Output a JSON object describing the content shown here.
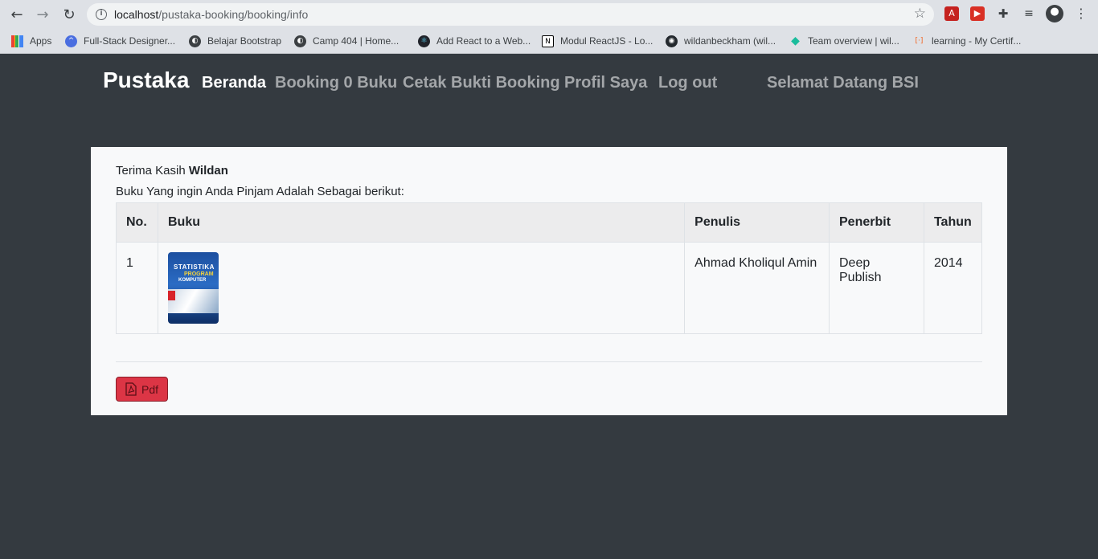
{
  "browser": {
    "url_host": "localhost",
    "url_path": "/pustaka-booking/booking/info",
    "bookmarks": [
      {
        "label": "Apps",
        "icon": "apps-grid-icon"
      },
      {
        "label": "Full-Stack Designer...",
        "icon": "site-icon"
      },
      {
        "label": "Belajar Bootstrap",
        "icon": "globe-icon"
      },
      {
        "label": "Camp 404 | Home...",
        "icon": "globe-icon"
      },
      {
        "label": "Add React to a Web...",
        "icon": "react-icon"
      },
      {
        "label": "Modul ReactJS - Lo...",
        "icon": "notion-icon"
      },
      {
        "label": "wildanbeckham (wil...",
        "icon": "github-icon"
      },
      {
        "label": "Team overview | wil...",
        "icon": "diamond-icon"
      },
      {
        "label": "learning - My Certif...",
        "icon": "code-icon"
      }
    ]
  },
  "navbar": {
    "brand": "Pustaka",
    "links": [
      "Beranda",
      "Booking 0 Buku",
      "Cetak Bukti Booking",
      "Profil Saya",
      "Log out"
    ],
    "welcome": "Selamat Datang BSI"
  },
  "info": {
    "thanks_prefix": "Terima Kasih",
    "name": "Wildan",
    "subtitle": "Buku Yang ingin Anda Pinjam Adalah Sebagai berikut:"
  },
  "table": {
    "headers": [
      "No.",
      "Buku",
      "Penulis",
      "Penerbit",
      "Tahun"
    ],
    "rows": [
      {
        "no": "1",
        "cover_title": "STATISTIKA",
        "cover_sub1": "PROGRAM",
        "cover_sub2": "KOMPUTER",
        "penulis": "Ahmad Kholiqul Amin",
        "penerbit": "Deep Publish",
        "tahun": "2014"
      }
    ]
  },
  "actions": {
    "pdf_label": "Pdf"
  },
  "colors": {
    "navbar_bg": "#343a40",
    "card_bg": "#f8f9fa",
    "pdf_button": "#dc3545"
  }
}
